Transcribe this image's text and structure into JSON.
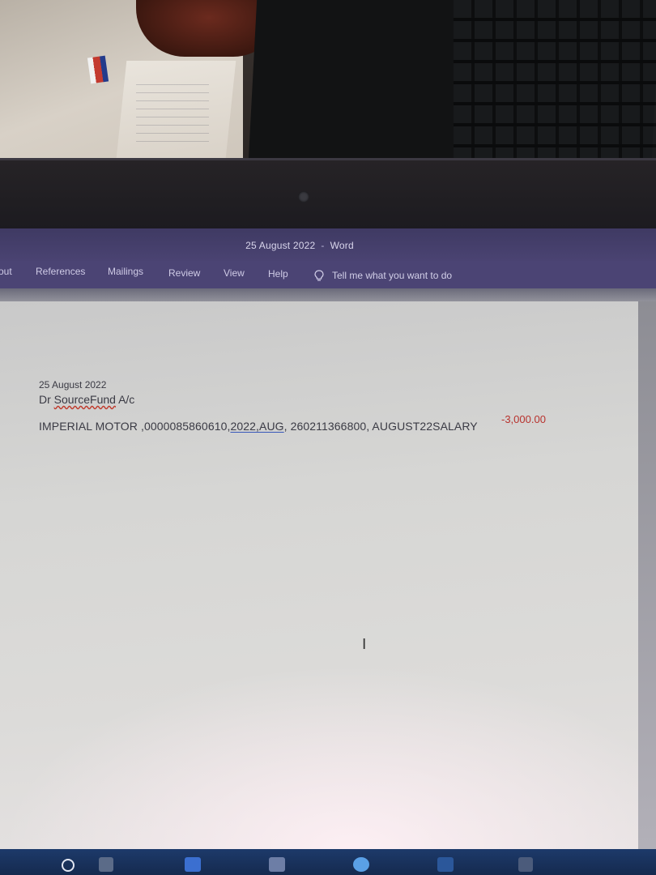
{
  "window": {
    "title_doc": "25 August 2022",
    "title_sep": "-",
    "title_app": "Word"
  },
  "ribbon": {
    "tabs": [
      {
        "label": "out"
      },
      {
        "label": "References"
      },
      {
        "label": "Mailings"
      },
      {
        "label": "Review"
      },
      {
        "label": "View"
      },
      {
        "label": "Help"
      }
    ],
    "tell_me": "Tell me what you want to do",
    "tell_me_icon": "lightbulb-icon"
  },
  "document": {
    "date": "25 August 2022",
    "account_prefix": "Dr ",
    "account_name": "SourceFund",
    "account_suffix": " A/c",
    "entry_part1": "IMPERIAL MOTOR ,0000085860610,",
    "entry_part2": "2022,AUG",
    "entry_part3": ", 260211366800, AUGUST22SALARY",
    "amount": "-3,000.00",
    "amount_color": "#b8322d"
  },
  "taskbar": {
    "icons": [
      "start-icon",
      "search-icon",
      "task-view-icon",
      "file-explorer-icon",
      "mail-icon",
      "store-icon",
      "browser-icon",
      "word-icon"
    ]
  }
}
